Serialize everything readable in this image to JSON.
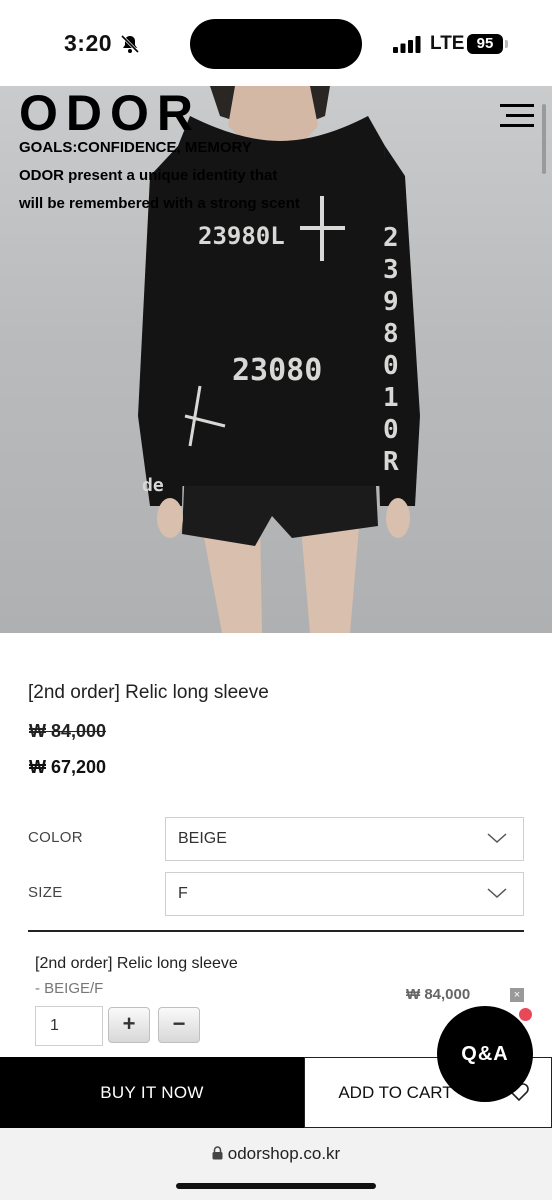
{
  "status_bar": {
    "time": "3:20",
    "network": "LTE",
    "battery": "95"
  },
  "hero": {
    "logo": "ODOR",
    "tagline_1": "GOALS:CONFIDENCE, MEMORY",
    "tagline_2": "ODOR present a unique identity that",
    "tagline_3": "will be remembered with a strong scent"
  },
  "product": {
    "name": "[2nd order] Relic long sleeve",
    "price_original": "₩ 84,000",
    "price_sale": "₩ 67,200"
  },
  "options": {
    "color_label": "COLOR",
    "color_value": "BEIGE",
    "size_label": "SIZE",
    "size_value": "F"
  },
  "selected": {
    "name": "[2nd order] Relic long sleeve",
    "variant": "- BEIGE/F",
    "price": "₩ 84,000",
    "quantity": "1",
    "plus": "+",
    "minus": "−",
    "remove": "×"
  },
  "actions": {
    "buy_now": "BUY IT NOW",
    "add_to_cart": "ADD TO CART",
    "qa": "Q&A"
  },
  "browser": {
    "url": "odorshop.co.kr"
  }
}
